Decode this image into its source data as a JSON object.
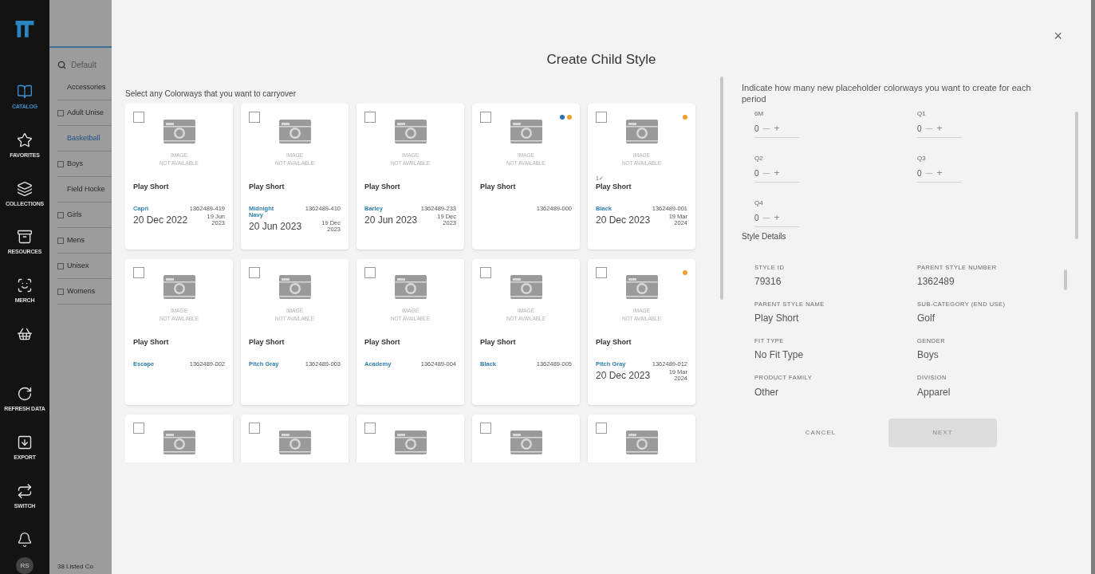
{
  "nav": [
    {
      "label": "CATALOG",
      "selected": true
    },
    {
      "label": "FAVORITES",
      "selected": false
    },
    {
      "label": "COLLECTIONS",
      "selected": false
    },
    {
      "label": "RESOURCES",
      "selected": false
    },
    {
      "label": "MERCH",
      "selected": false
    },
    {
      "selected": false
    },
    {
      "label": "REFRESH DATA",
      "selected": false
    },
    {
      "label": "EXPORT",
      "selected": false
    },
    {
      "label": "SWITCH",
      "selected": false
    },
    {
      "selected": false
    }
  ],
  "avatar": "RS",
  "catalog": {
    "search": "Default",
    "items": [
      {
        "label": "Accessories",
        "expandable": false,
        "selected": false
      },
      {
        "label": "Adult Unise",
        "expandable": true,
        "selected": false
      },
      {
        "label": "Basketball",
        "expandable": false,
        "selected": true
      },
      {
        "label": "Boys",
        "expandable": true,
        "selected": false
      },
      {
        "label": "Field Hocke",
        "expandable": false,
        "selected": false
      },
      {
        "label": "Girls",
        "expandable": true,
        "selected": false
      },
      {
        "label": "Mens",
        "expandable": true,
        "selected": false
      },
      {
        "label": "Unisex",
        "expandable": true,
        "selected": false
      },
      {
        "label": "Womens",
        "expandable": true,
        "selected": false
      }
    ],
    "footer": "38 Listed Co"
  },
  "dialog": {
    "title": "Create Child Style",
    "close": "×",
    "prompt": "Select any Colorways that you want to carryover",
    "cards": [
      {
        "kind": "full",
        "checked": false,
        "image_text": "IMAGE\nNOT AVAILABLE",
        "name": "Play Short",
        "colorway": "Capri",
        "number": "1362489-419",
        "date": "20 Dec 2022",
        "date_small": "19 Jun\n2023"
      },
      {
        "kind": "full",
        "checked": false,
        "image_text": "IMAGE\nNOT AVAILABLE",
        "name": "Play Short",
        "colorway": "Midnight Navy",
        "number": "1362489-410",
        "date": "20 Jun 2023",
        "date_small": "19 Dec\n2023"
      },
      {
        "kind": "full",
        "checked": false,
        "image_text": "IMAGE\nNOT AVAILABLE",
        "name": "Play Short",
        "colorway": "Barley",
        "number": "1362489-233",
        "date": "20 Jun 2023",
        "date_small": "19 Dec\n2023"
      },
      {
        "kind": "full",
        "checked": false,
        "image_text": "IMAGE\nNOT AVAILABLE",
        "name": "Play Short",
        "number": "1362489-000",
        "dots": [
          {
            "color": "#2f6db5"
          },
          {
            "color": "#f0a030"
          }
        ]
      },
      {
        "kind": "full",
        "checked": false,
        "image_text": "IMAGE\nNOT AVAILABLE",
        "badge": "1✓",
        "name": "Play Short",
        "colorway": "Black",
        "number": "1362489-001",
        "date": "20 Dec 2023",
        "date_small": "19 Mar\n2024",
        "dots": [
          {
            "color": "#f0a030"
          }
        ]
      },
      {
        "kind": "full",
        "checked": false,
        "image_text": "IMAGE\nNOT AVAILABLE",
        "name": "Play Short",
        "colorway": "Escape",
        "number": "1362489-002"
      },
      {
        "kind": "full",
        "checked": false,
        "image_text": "IMAGE\nNOT AVAILABLE",
        "name": "Play Short",
        "colorway": "Pitch Gray",
        "number": "1362489-003"
      },
      {
        "kind": "full",
        "checked": false,
        "image_text": "IMAGE\nNOT AVAILABLE",
        "name": "Play Short",
        "colorway": "Academy",
        "number": "1362489-004"
      },
      {
        "kind": "full",
        "checked": false,
        "image_text": "IMAGE\nNOT AVAILABLE",
        "name": "Play Short",
        "colorway": "Black",
        "number": "1362489-005"
      },
      {
        "kind": "full",
        "checked": false,
        "image_text": "IMAGE\nNOT AVAILABLE",
        "name": "Play Short",
        "colorway": "Pitch Gray",
        "number": "1362489-012",
        "date": "20 Dec 2023",
        "date_small": "19 Mar\n2024",
        "dots": [
          {
            "color": "#f0a030"
          }
        ]
      },
      {
        "kind": "partial",
        "checked": false
      },
      {
        "kind": "partial",
        "checked": false
      },
      {
        "kind": "partial",
        "checked": false
      },
      {
        "kind": "partial",
        "checked": false
      },
      {
        "kind": "partial",
        "checked": false
      }
    ],
    "placeholder_prompt": "Indicate how many new placeholder colorways you want to create for each period",
    "counters": [
      {
        "label": "6M",
        "value": "0",
        "minus": "—",
        "plus": "+"
      },
      {
        "label": "Q1",
        "value": "0",
        "minus": "—",
        "plus": "+"
      },
      {
        "label": "Q2",
        "value": "0",
        "minus": "—",
        "plus": "+"
      },
      {
        "label": "Q3",
        "value": "0",
        "minus": "—",
        "plus": "+"
      },
      {
        "label": "Q4",
        "value": "0",
        "minus": "—",
        "plus": "+"
      }
    ],
    "details_title": "Style Details",
    "details": [
      {
        "label": "STYLE ID",
        "value": "79316"
      },
      {
        "label": "PARENT STYLE NUMBER",
        "value": "1362489"
      },
      {
        "label": "PARENT STYLE NAME",
        "value": "Play Short"
      },
      {
        "label": "SUB-CATEGORY (END USE)",
        "value": "Golf"
      },
      {
        "label": "FIT TYPE",
        "value": "No Fit Type"
      },
      {
        "label": "GENDER",
        "value": "Boys"
      },
      {
        "label": "PRODUCT FAMILY",
        "value": "Other"
      },
      {
        "label": "DIVISION",
        "value": "Apparel"
      }
    ],
    "buttons": [
      {
        "label": "CANCEL",
        "kind": "text",
        "disabled": false
      },
      {
        "label": "NEXT",
        "kind": "filled",
        "disabled": true
      }
    ]
  }
}
